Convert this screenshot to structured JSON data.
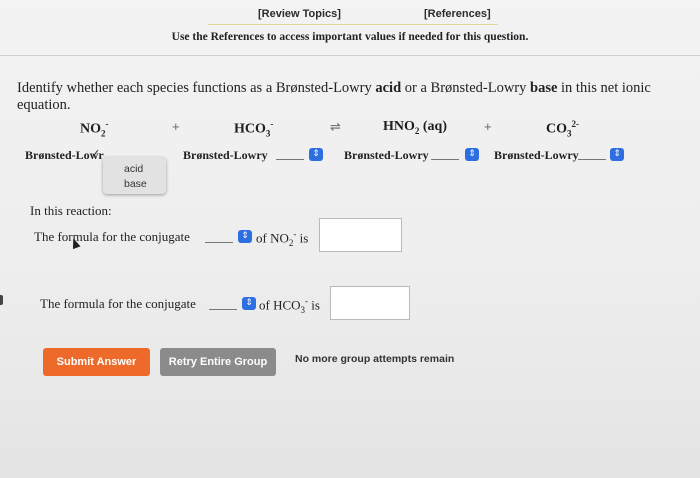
{
  "header": {
    "review_link": "[Review Topics]",
    "references_link": "[References]",
    "notice": "Use the References to access important values if needed for this question."
  },
  "question": {
    "prefix": "Identify whether each species functions as a Brønsted-Lowry ",
    "acid_word": "acid",
    "middle": " or a Brønsted-Lowry ",
    "base_word": "base",
    "suffix": " in this net ionic equation."
  },
  "equation": {
    "species": [
      {
        "base": "NO",
        "sub": "2",
        "sup": "-"
      },
      {
        "base": "HCO",
        "sub": "3",
        "sup": "-"
      },
      {
        "base": "HNO",
        "sub": "2",
        "sup": "",
        "tail": " (aq)"
      },
      {
        "base": "CO",
        "sub": "3",
        "sup": "2-"
      }
    ],
    "plus": "+",
    "arrow": "⇌"
  },
  "labels": {
    "l1": "Brønsted-Lowr",
    "l2": "Brønsted-Lowry",
    "l3": "Brønsted-Lowry",
    "l4": "Brønsted-Lowry",
    "checkmark": "✓"
  },
  "dropdown": {
    "options": [
      "acid",
      "base"
    ]
  },
  "reaction": {
    "heading": "In this reaction:",
    "line1_prefix": "The formula for the conjugate",
    "line1_suffix_of": "of NO",
    "line1_sub": "2",
    "line1_sup": "-",
    "line1_is": " is",
    "line2_prefix": "The formula for the conjugate",
    "line2_suffix_of": "of HCO",
    "line2_sub": "3",
    "line2_sup": "-",
    "line2_is": " is"
  },
  "buttons": {
    "submit": "Submit Answer",
    "retry": "Retry Entire Group",
    "remain": "No more group attempts remain"
  },
  "icons": {
    "select": "updown-chevron-icon",
    "cursor": "mouse-pointer-icon"
  },
  "colors": {
    "submit": "#ee6a2a",
    "retry": "#8b8b8b",
    "select_blue": "#2d6fe0"
  }
}
